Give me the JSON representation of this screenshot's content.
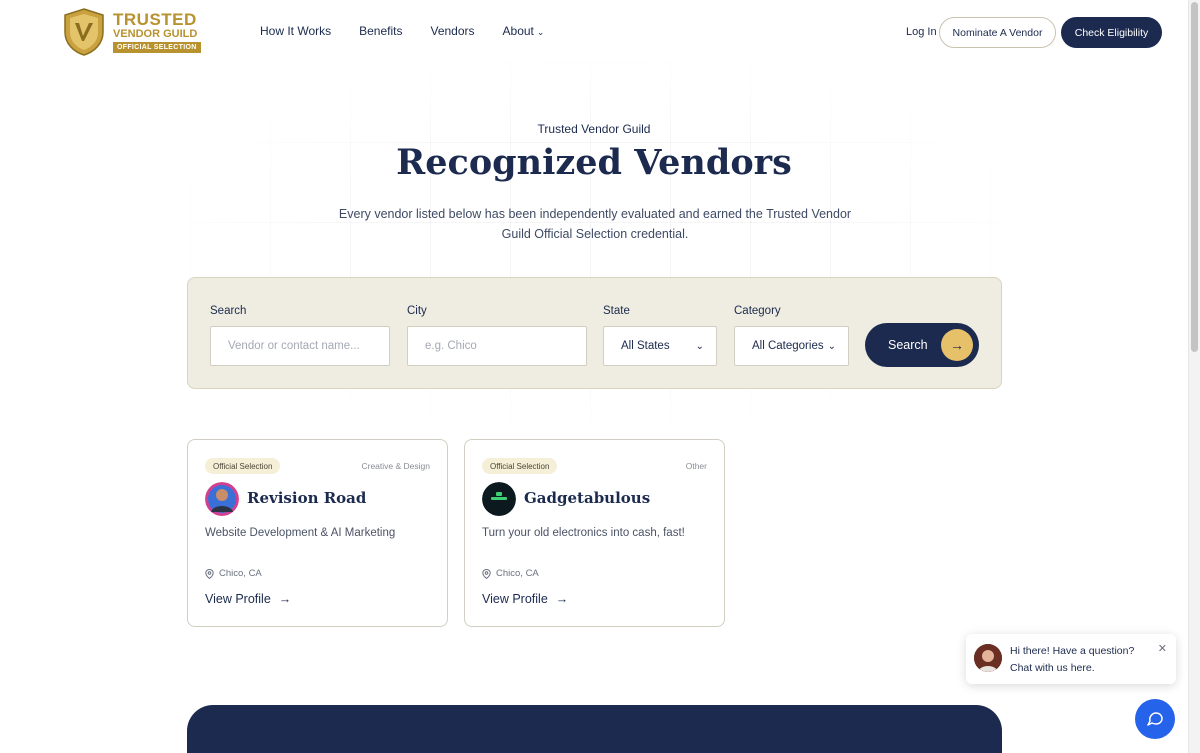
{
  "header": {
    "logo": {
      "line1": "TRUSTED",
      "line2": "VENDOR GUILD",
      "line3": "OFFICIAL SELECTION"
    },
    "nav": [
      "How It Works",
      "Benefits",
      "Vendors",
      "About"
    ],
    "login_label": "Log In",
    "nominate_label": "Nominate A Vendor",
    "eligibility_label": "Check Eligibility"
  },
  "hero": {
    "eyebrow": "Trusted Vendor Guild",
    "title": "Recognized Vendors",
    "subtitle": "Every vendor listed below has been independently evaluated and earned the Trusted Vendor Guild Official Selection credential."
  },
  "search": {
    "search_label": "Search",
    "search_placeholder": "Vendor or contact name...",
    "city_label": "City",
    "city_placeholder": "e.g. Chico",
    "state_label": "State",
    "state_value": "All States",
    "category_label": "Category",
    "category_value": "All Categories",
    "button_label": "Search"
  },
  "vendors": [
    {
      "badge": "Official Selection",
      "category": "Creative & Design",
      "name": "Revision Road",
      "description": "Website Development & AI Marketing",
      "location": "Chico, CA",
      "link": "View Profile"
    },
    {
      "badge": "Official Selection",
      "category": "Other",
      "name": "Gadgetabulous",
      "description": "Turn your old electronics into cash, fast!",
      "location": "Chico, CA",
      "link": "View Profile"
    }
  ],
  "chat": {
    "message": "Hi there! Have a question? Chat with us here."
  },
  "colors": {
    "navy": "#1b2a4e",
    "gold": "#b8922f",
    "accent_yellow": "#e7c06a",
    "panel_bg": "#efede1",
    "chat_blue": "#2563eb"
  }
}
